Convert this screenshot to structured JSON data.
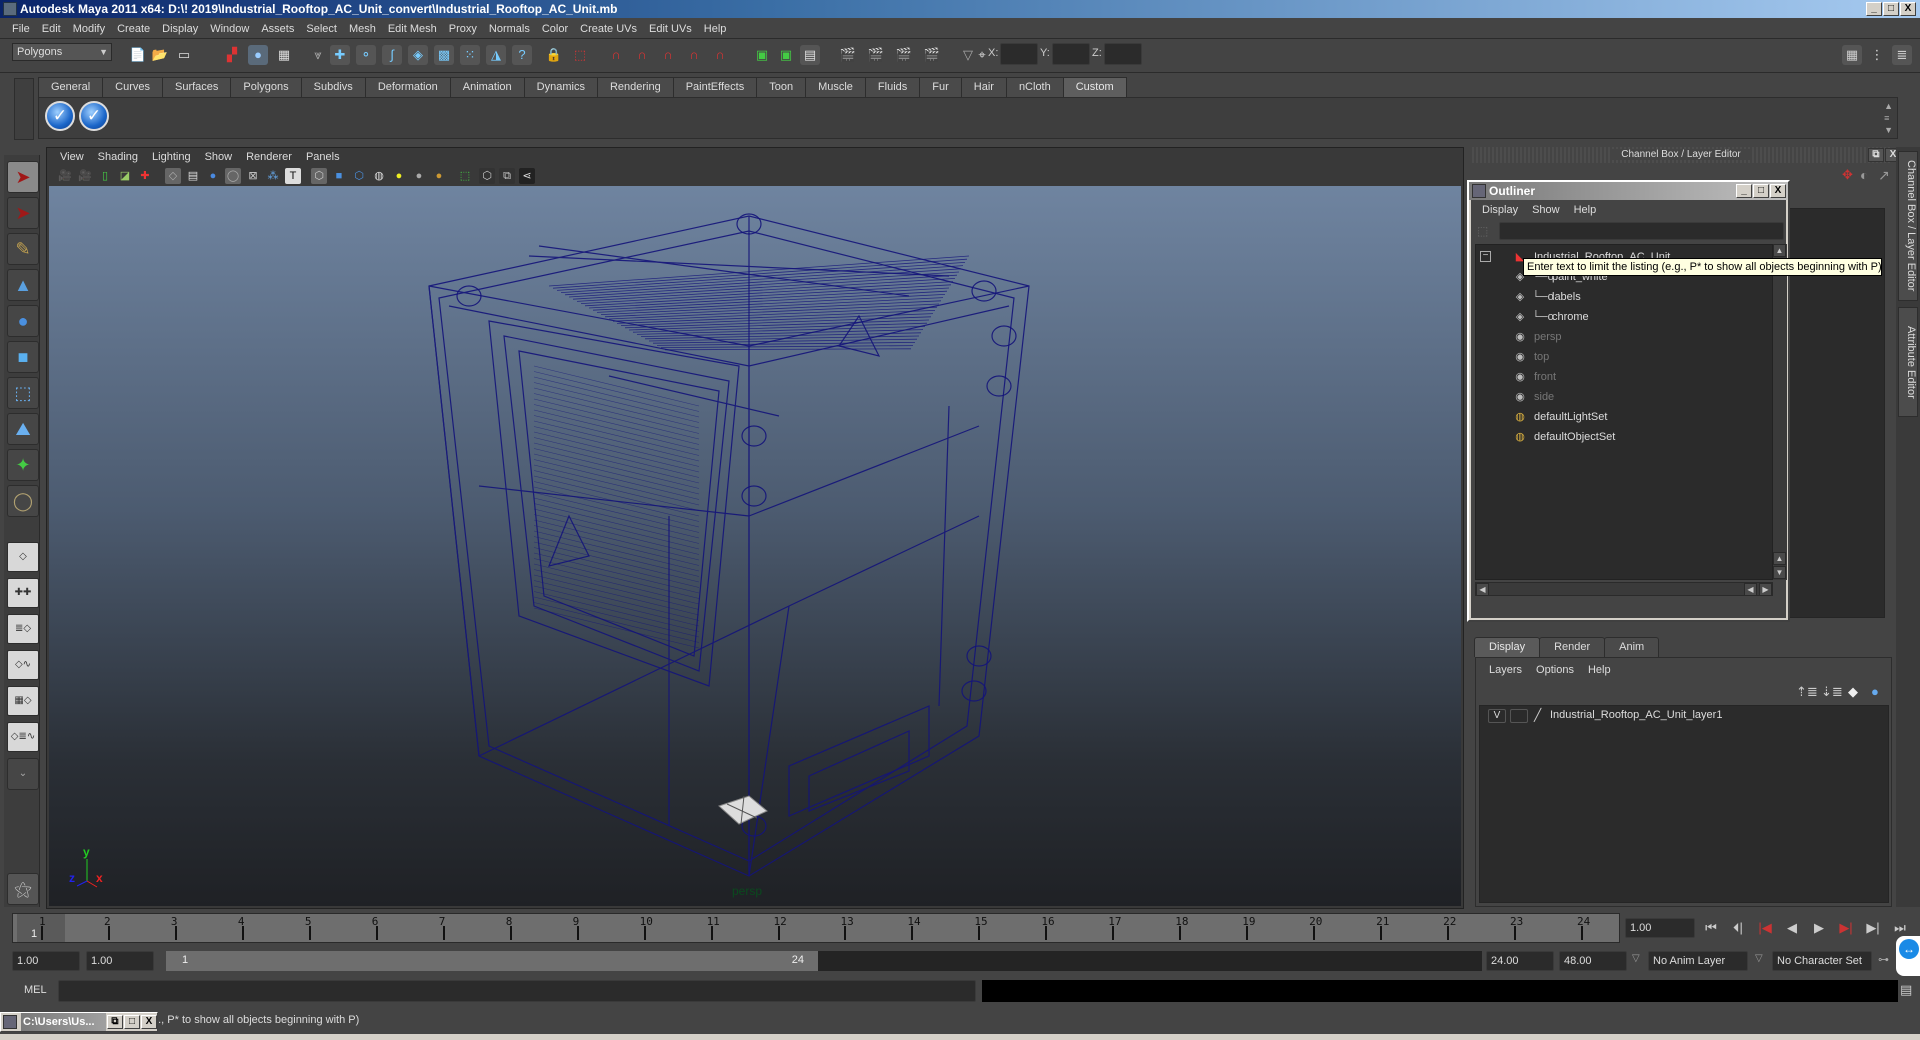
{
  "window": {
    "title": "Autodesk Maya 2011 x64: D:\\! 2019\\Industrial_Rooftop_AC_Unit_convert\\Industrial_Rooftop_AC_Unit.mb",
    "controls": {
      "minimize": "_",
      "maximize": "□",
      "close": "X"
    }
  },
  "menubar": [
    "File",
    "Edit",
    "Modify",
    "Create",
    "Display",
    "Window",
    "Assets",
    "Select",
    "Mesh",
    "Edit Mesh",
    "Proxy",
    "Normals",
    "Color",
    "Create UVs",
    "Edit UVs",
    "Help"
  ],
  "statusline": {
    "mode_selector": "Polygons",
    "x_label": "X:",
    "y_label": "Y:",
    "z_label": "Z:",
    "x_value": "",
    "y_value": "",
    "z_value": ""
  },
  "shelf": {
    "tabs": [
      "General",
      "Curves",
      "Surfaces",
      "Polygons",
      "Subdivs",
      "Deformation",
      "Animation",
      "Dynamics",
      "Rendering",
      "PaintEffects",
      "Toon",
      "Muscle",
      "Fluids",
      "Fur",
      "Hair",
      "nCloth",
      "Custom"
    ],
    "active_tab": "Custom",
    "buttons": [
      "checkmark-button-1",
      "checkmark-button-2"
    ]
  },
  "toolbox": {
    "tools": [
      "select-tool",
      "lasso-tool",
      "paint-select-tool",
      "move-tool",
      "rotate-tool",
      "scale-tool",
      "universal-manipulator",
      "soft-modification-tool",
      "show-manipulator",
      "last-tool-used"
    ],
    "layouts": [
      "single-perspective-view",
      "four-view",
      "outliner-perspective",
      "perspective-graph",
      "hypershade-perspective",
      "persp-outliner-graph"
    ]
  },
  "viewport": {
    "menu": [
      "View",
      "Shading",
      "Lighting",
      "Show",
      "Renderer",
      "Panels"
    ],
    "camera_label": "persp",
    "axis": {
      "x": "x",
      "y": "y",
      "z": "z"
    },
    "wire_color": "#1a1a8a"
  },
  "channel_box": {
    "header": "Channel Box / Layer Editor",
    "side_tabs": [
      "Channel Box / Layer Editor",
      "Attribute Editor"
    ]
  },
  "outliner": {
    "title": "Outliner",
    "menu": [
      "Display",
      "Show",
      "Help"
    ],
    "filter_value": "",
    "items": [
      {
        "label": "Industrial_Rooftop_AC_Unit",
        "type": "group",
        "dim": false,
        "child": false
      },
      {
        "label": "paint_white",
        "type": "mesh",
        "dim": false,
        "child": true
      },
      {
        "label": "labels",
        "type": "mesh",
        "dim": false,
        "child": true
      },
      {
        "label": "chrome",
        "type": "mesh",
        "dim": false,
        "child": true
      },
      {
        "label": "persp",
        "type": "camera",
        "dim": true,
        "child": false
      },
      {
        "label": "top",
        "type": "camera",
        "dim": true,
        "child": false
      },
      {
        "label": "front",
        "type": "camera",
        "dim": true,
        "child": false
      },
      {
        "label": "side",
        "type": "camera",
        "dim": true,
        "child": false
      },
      {
        "label": "defaultLightSet",
        "type": "set",
        "dim": false,
        "child": false
      },
      {
        "label": "defaultObjectSet",
        "type": "set",
        "dim": false,
        "child": false
      }
    ],
    "tooltip": "Enter text to limit the listing (e.g., P* to show all objects beginning with P)"
  },
  "layer_editor": {
    "tabs": [
      "Display",
      "Render",
      "Anim"
    ],
    "active_tab": "Display",
    "menu": [
      "Layers",
      "Options",
      "Help"
    ],
    "layers": [
      {
        "visibility": "V",
        "name": "Industrial_Rooftop_AC_Unit_layer1"
      }
    ]
  },
  "timeline": {
    "ticks": [
      "1",
      "2",
      "3",
      "4",
      "5",
      "6",
      "7",
      "8",
      "9",
      "10",
      "11",
      "12",
      "13",
      "14",
      "15",
      "16",
      "17",
      "18",
      "19",
      "20",
      "21",
      "22",
      "23",
      "24"
    ],
    "current_frame_marker": "1",
    "current_frame": "1.00"
  },
  "playback": {
    "buttons": [
      "go-to-start",
      "step-back-key",
      "step-back-frame",
      "play-backward",
      "play-forward",
      "step-forward-frame",
      "step-forward-key",
      "go-to-end"
    ]
  },
  "range": {
    "start_time": "1.00",
    "playback_start": "1.00",
    "range_start_label": "1",
    "range_end_label": "24",
    "playback_end": "24.00",
    "end_time": "48.00",
    "anim_layer": "No Anim Layer",
    "character_set": "No Character Set"
  },
  "commandline": {
    "label": "MEL",
    "input": ""
  },
  "helpline": {
    "text": "g., P* to show all objects beginning with P)"
  },
  "taskbar_mini": {
    "label": "C:\\Users\\Us..."
  }
}
